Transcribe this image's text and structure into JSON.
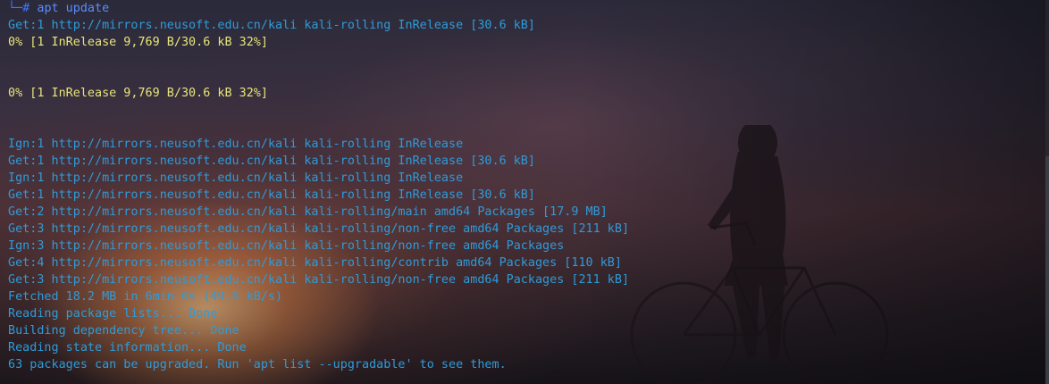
{
  "prompt": {
    "corner": "└─",
    "symbol": "#",
    "command": "apt update"
  },
  "output": [
    {
      "text": "Get:1 http://mirrors.neusoft.edu.cn/kali kali-rolling InRelease [30.6 kB]",
      "color": "cyan"
    },
    {
      "text": "0% [1 InRelease 9,769 B/30.6 kB 32%]",
      "color": "yellow"
    },
    {
      "text": "",
      "color": "blank"
    },
    {
      "text": "",
      "color": "blank"
    },
    {
      "text": "0% [1 InRelease 9,769 B/30.6 kB 32%]",
      "color": "yellow"
    },
    {
      "text": "",
      "color": "blank"
    },
    {
      "text": "",
      "color": "blank"
    },
    {
      "text": "Ign:1 http://mirrors.neusoft.edu.cn/kali kali-rolling InRelease",
      "color": "cyan"
    },
    {
      "text": "Get:1 http://mirrors.neusoft.edu.cn/kali kali-rolling InRelease [30.6 kB]",
      "color": "cyan"
    },
    {
      "text": "Ign:1 http://mirrors.neusoft.edu.cn/kali kali-rolling InRelease",
      "color": "cyan"
    },
    {
      "text": "Get:1 http://mirrors.neusoft.edu.cn/kali kali-rolling InRelease [30.6 kB]",
      "color": "cyan"
    },
    {
      "text": "Get:2 http://mirrors.neusoft.edu.cn/kali kali-rolling/main amd64 Packages [17.9 MB]",
      "color": "cyan"
    },
    {
      "text": "Get:3 http://mirrors.neusoft.edu.cn/kali kali-rolling/non-free amd64 Packages [211 kB]",
      "color": "cyan"
    },
    {
      "text": "Ign:3 http://mirrors.neusoft.edu.cn/kali kali-rolling/non-free amd64 Packages",
      "color": "cyan"
    },
    {
      "text": "Get:4 http://mirrors.neusoft.edu.cn/kali kali-rolling/contrib amd64 Packages [110 kB]",
      "color": "cyan"
    },
    {
      "text": "Get:3 http://mirrors.neusoft.edu.cn/kali kali-rolling/non-free amd64 Packages [211 kB]",
      "color": "cyan"
    },
    {
      "text": "Fetched 18.2 MB in 6min 6s (49.8 kB/s)",
      "color": "cyan"
    },
    {
      "text": "Reading package lists... Done",
      "color": "cyan"
    },
    {
      "text": "Building dependency tree... Done",
      "color": "cyan"
    },
    {
      "text": "Reading state information... Done",
      "color": "cyan"
    },
    {
      "text": "63 packages can be upgraded. Run 'apt list --upgradable' to see them.",
      "color": "cyan"
    }
  ],
  "colors": {
    "cyan": "#2f9bd9",
    "yellow": "#e8e57a",
    "prompt": "#3b78ff"
  }
}
